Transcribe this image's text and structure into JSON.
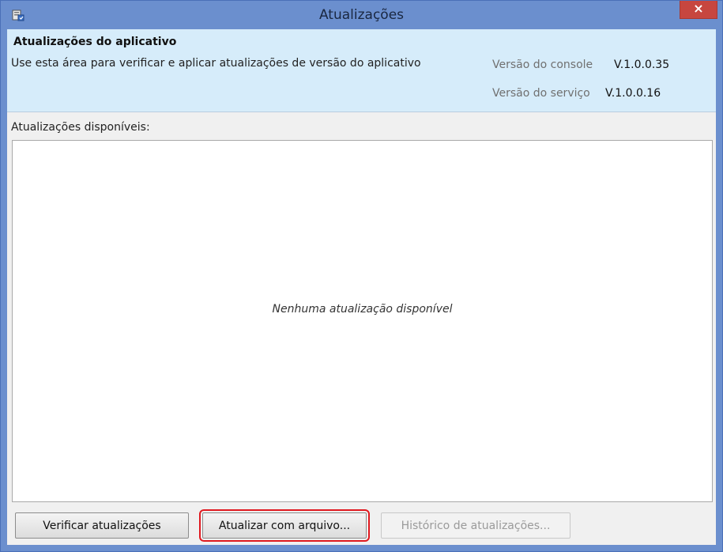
{
  "window": {
    "title": "Atualizações",
    "close_label": "×"
  },
  "header": {
    "title": "Atualizações do aplicativo",
    "description": "Use esta área para verificar e aplicar atualizações de versão do aplicativo",
    "console_label": "Versão do console",
    "console_version": "V.1.0.0.35",
    "service_label": "Versão do serviço",
    "service_version": "V.1.0.0.16"
  },
  "updates": {
    "label": "Atualizações disponíveis:",
    "empty_message": "Nenhuma atualização disponível"
  },
  "buttons": {
    "check_label": "Verificar atualizações",
    "from_file_label": "Atualizar com arquivo...",
    "history_label": "Histórico de atualizações..."
  },
  "colors": {
    "titlebar": "#6b8fce",
    "header_bg": "#d6ecfa",
    "close_button": "#c7463f",
    "highlight": "#e0191f"
  }
}
